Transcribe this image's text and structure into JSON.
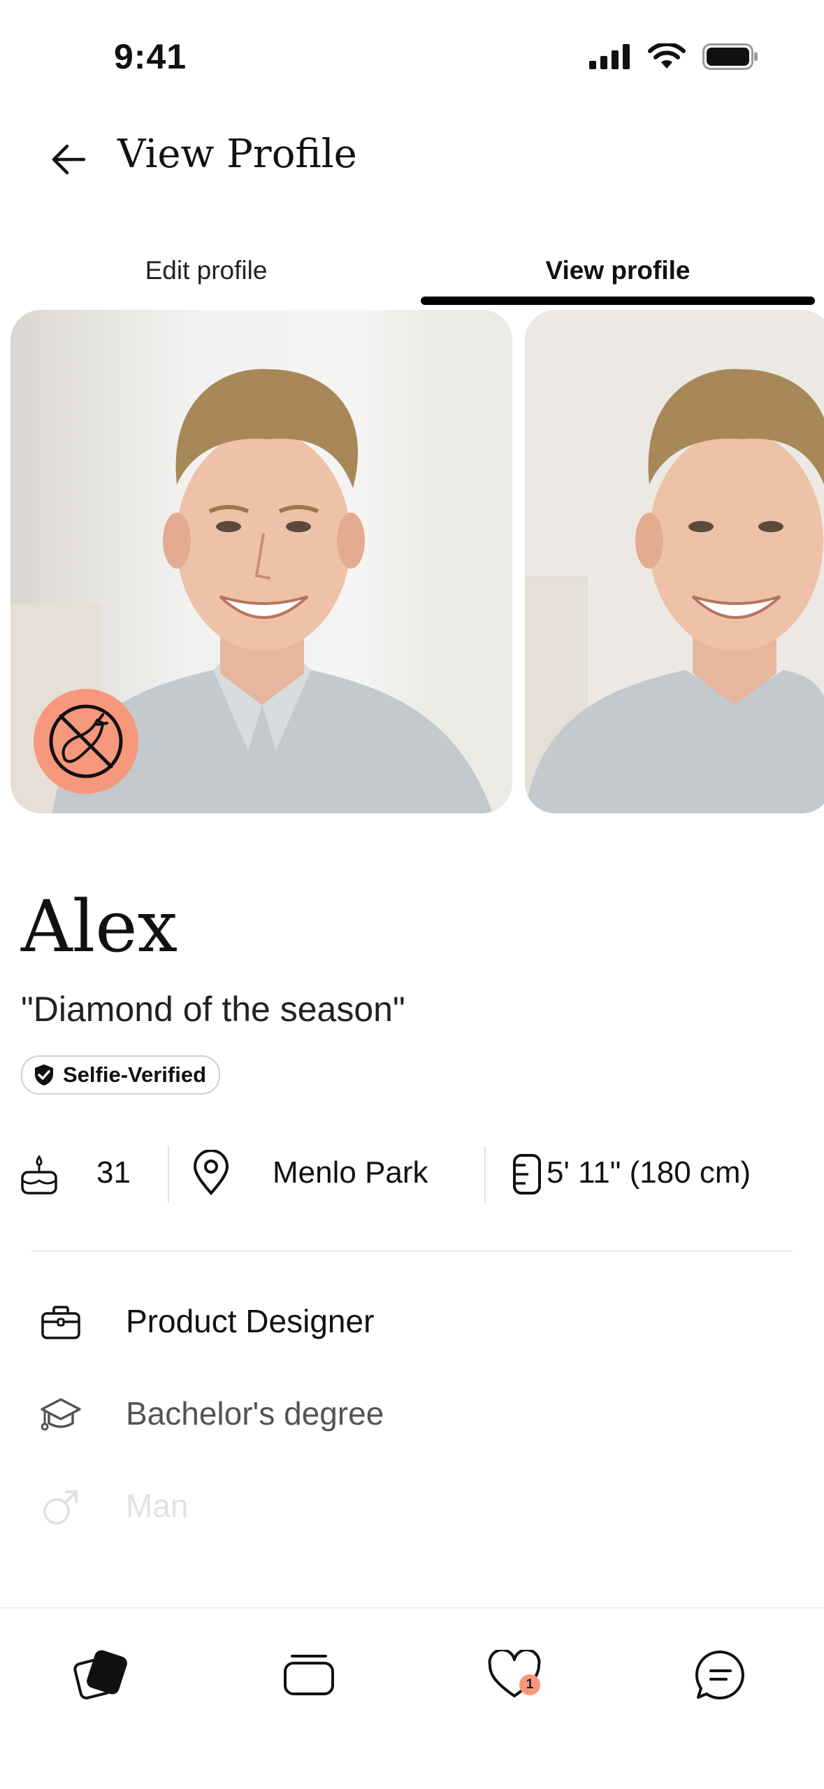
{
  "status_bar": {
    "time": "9:41"
  },
  "header": {
    "title": "View Profile"
  },
  "tabs": [
    {
      "label": "Edit profile",
      "active": false
    },
    {
      "label": "View profile",
      "active": true
    }
  ],
  "profile": {
    "name": "Alex",
    "tagline": "\"Diamond of the season\"",
    "verified_label": "Selfie-Verified",
    "age": "31",
    "location": "Menlo Park",
    "height": "5' 11\" (180 cm)",
    "details": [
      {
        "icon": "briefcase-icon",
        "label": "Product Designer"
      },
      {
        "icon": "graduation-cap-icon",
        "label": "Bachelor's degree"
      },
      {
        "icon": "male-gender-icon",
        "label": "Man"
      }
    ]
  },
  "nav": {
    "items": [
      "cards-icon",
      "stack-icon",
      "likes-heart-icon",
      "chat-icon"
    ],
    "likes_badge": "1"
  },
  "colors": {
    "accent": "#f7977c",
    "text": "#111111"
  }
}
